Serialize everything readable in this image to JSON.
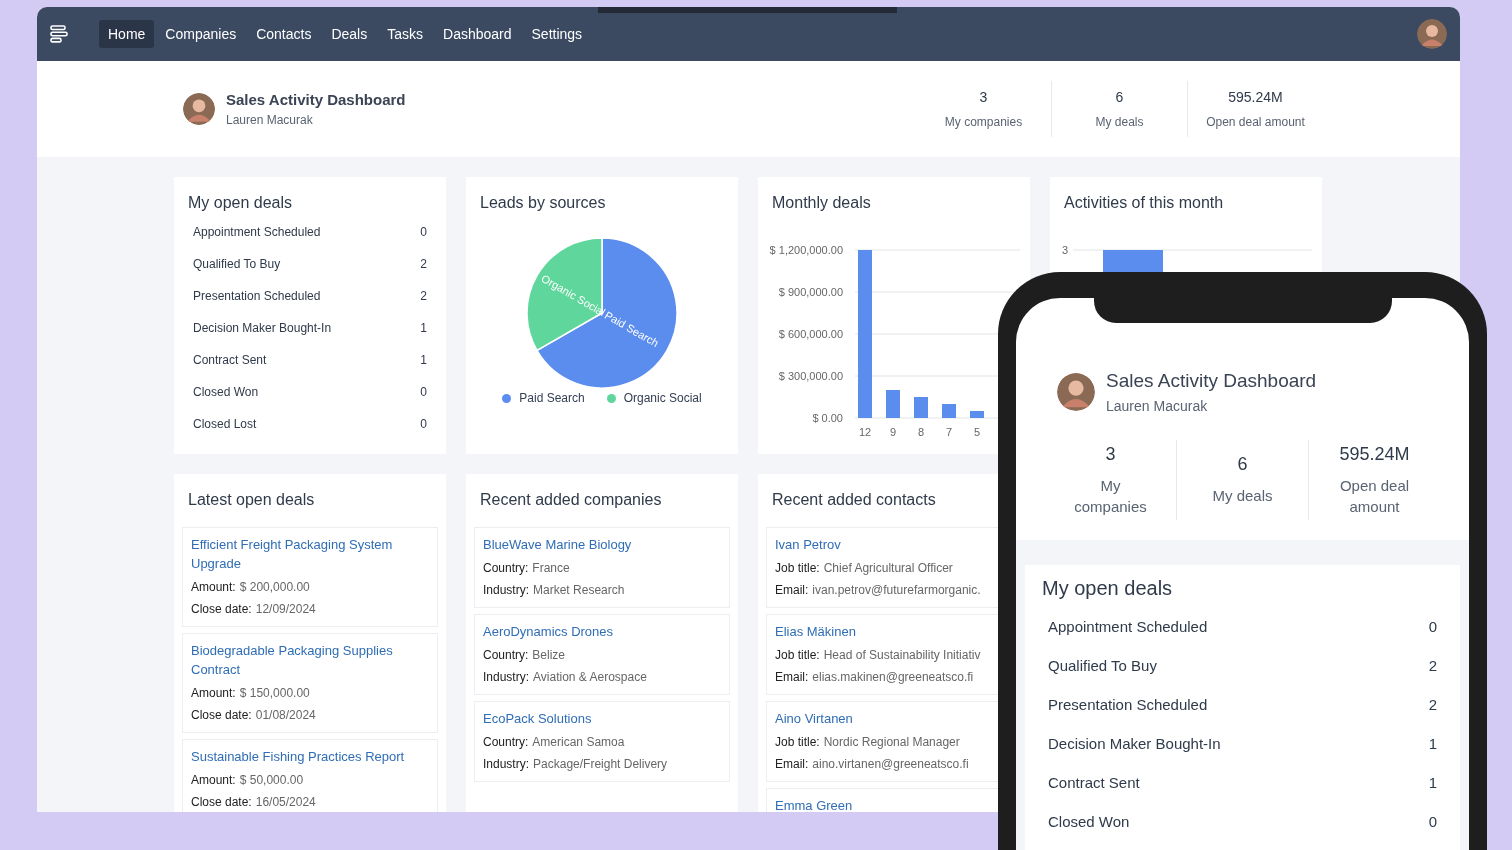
{
  "nav": {
    "items": [
      {
        "label": "Home",
        "selected": true
      },
      {
        "label": "Companies",
        "selected": false
      },
      {
        "label": "Contacts",
        "selected": false
      },
      {
        "label": "Deals",
        "selected": false
      },
      {
        "label": "Tasks",
        "selected": false
      },
      {
        "label": "Dashboard",
        "selected": false
      },
      {
        "label": "Settings",
        "selected": false
      }
    ]
  },
  "header": {
    "title": "Sales Activity Dashboard",
    "subtitle": "Lauren Macurak",
    "stats": [
      {
        "value": "3",
        "label": "My companies"
      },
      {
        "value": "6",
        "label": "My deals"
      },
      {
        "value": "595.24M",
        "label": "Open deal amount"
      }
    ]
  },
  "open_deals": {
    "title": "My open deals",
    "rows": [
      {
        "label": "Appointment Scheduled",
        "count": "0"
      },
      {
        "label": "Qualified To Buy",
        "count": "2"
      },
      {
        "label": "Presentation Scheduled",
        "count": "2"
      },
      {
        "label": "Decision Maker Bought-In",
        "count": "1"
      },
      {
        "label": "Contract Sent",
        "count": "1"
      },
      {
        "label": "Closed Won",
        "count": "0"
      },
      {
        "label": "Closed Lost",
        "count": "0"
      }
    ]
  },
  "leads": {
    "title": "Leads by sources",
    "chart_data": {
      "type": "pie",
      "categories": [
        "Paid Search",
        "Organic Social"
      ],
      "series": [
        {
          "values": [
            66.7,
            33.3
          ]
        }
      ]
    },
    "legend": [
      {
        "label": "Paid Search",
        "color": "#5b8def"
      },
      {
        "label": "Organic Social",
        "color": "#5fd69b"
      }
    ]
  },
  "monthly": {
    "title": "Monthly deals",
    "chart_data": {
      "type": "bar",
      "grid": true,
      "categories": [
        "12",
        "9",
        "8",
        "7",
        "5"
      ],
      "ylim": [
        0,
        1200000
      ],
      "yticks": [
        {
          "value": 0,
          "label": "$ 0.00"
        },
        {
          "value": 300000,
          "label": "$ 300,000.00"
        },
        {
          "value": 600000,
          "label": "$ 600,000.00"
        },
        {
          "value": 900000,
          "label": "$ 900,000.00"
        },
        {
          "value": 1200000,
          "label": "$ 1,200,000.00"
        }
      ],
      "series": [
        {
          "color": "#5b8def",
          "values": [
            1200000,
            200000,
            150000,
            100000,
            50000
          ]
        }
      ]
    }
  },
  "activities": {
    "title": "Activities of this month",
    "tick_label": "3"
  },
  "latest_deals": {
    "title": "Latest open deals",
    "items": [
      {
        "name": "Efficient Freight Packaging System Upgrade",
        "fields": [
          {
            "label": "Amount:",
            "value": "$ 200,000.00"
          },
          {
            "label": "Close date:",
            "value": "12/09/2024"
          }
        ]
      },
      {
        "name": "Biodegradable Packaging Supplies Contract",
        "fields": [
          {
            "label": "Amount:",
            "value": "$ 150,000.00"
          },
          {
            "label": "Close date:",
            "value": "01/08/2024"
          }
        ]
      },
      {
        "name": "Sustainable Fishing Practices Report",
        "fields": [
          {
            "label": "Amount:",
            "value": "$ 50,000.00"
          },
          {
            "label": "Close date:",
            "value": "16/05/2024"
          }
        ]
      }
    ]
  },
  "companies": {
    "title": "Recent added companies",
    "items": [
      {
        "name": "BlueWave Marine Biology",
        "fields": [
          {
            "label": "Country:",
            "value": "France"
          },
          {
            "label": "Industry:",
            "value": "Market Research"
          }
        ]
      },
      {
        "name": "AeroDynamics Drones",
        "fields": [
          {
            "label": "Country:",
            "value": "Belize"
          },
          {
            "label": "Industry:",
            "value": "Aviation & Aerospace"
          }
        ]
      },
      {
        "name": "EcoPack Solutions",
        "fields": [
          {
            "label": "Country:",
            "value": "American Samoa"
          },
          {
            "label": "Industry:",
            "value": "Package/Freight Delivery"
          }
        ]
      }
    ]
  },
  "contacts": {
    "title": "Recent added contacts",
    "items": [
      {
        "name": "Ivan Petrov",
        "fields": [
          {
            "label": "Job title:",
            "value": "Chief Agricultural Officer"
          },
          {
            "label": "Email:",
            "value": "ivan.petrov@futurefarmorganic."
          }
        ]
      },
      {
        "name": "Elias Mäkinen",
        "fields": [
          {
            "label": "Job title:",
            "value": "Head of Sustainability Initiativ"
          },
          {
            "label": "Email:",
            "value": "elias.makinen@greeneatsco.fi"
          }
        ]
      },
      {
        "name": "Aino Virtanen",
        "fields": [
          {
            "label": "Job title:",
            "value": "Nordic Regional Manager"
          },
          {
            "label": "Email:",
            "value": "aino.virtanen@greeneatsco.fi"
          }
        ]
      },
      {
        "name": "Emma Green"
      }
    ]
  },
  "phone": {
    "header": {
      "title": "Sales Activity Dashboard",
      "subtitle": "Lauren Macurak",
      "stats": [
        {
          "value": "3",
          "label": "My companies"
        },
        {
          "value": "6",
          "label": "My deals"
        },
        {
          "value": "595.24M",
          "label": "Open deal amount"
        }
      ]
    },
    "open_deals": {
      "title": "My open deals",
      "rows": [
        {
          "label": "Appointment Scheduled",
          "count": "0"
        },
        {
          "label": "Qualified To Buy",
          "count": "2"
        },
        {
          "label": "Presentation Scheduled",
          "count": "2"
        },
        {
          "label": "Decision Maker Bought-In",
          "count": "1"
        },
        {
          "label": "Contract Sent",
          "count": "1"
        },
        {
          "label": "Closed Won",
          "count": "0"
        }
      ]
    }
  }
}
